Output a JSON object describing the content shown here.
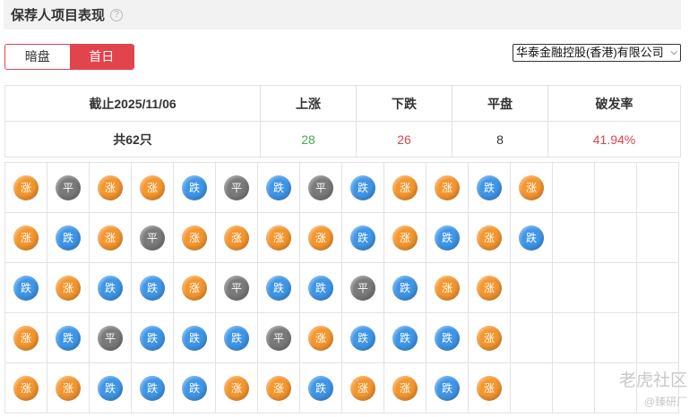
{
  "header": {
    "title": "保荐人项目表现",
    "help": "?"
  },
  "tabs": {
    "items": [
      {
        "label": "暗盘"
      },
      {
        "label": "首日"
      }
    ],
    "active": 1
  },
  "sponsor_select": {
    "value": "华泰金融控股(香港)有限公司"
  },
  "stats": {
    "as_of": "截止2025/11/06",
    "col_up": "上涨",
    "col_down": "下跌",
    "col_flat": "平盘",
    "col_rate": "破发率",
    "total": "共62只",
    "up": "28",
    "down": "26",
    "flat": "8",
    "rate": "41.94%"
  },
  "labels": {
    "up": "涨",
    "down": "跌",
    "flat": "平"
  },
  "colors": {
    "up": "#f5962e",
    "down": "#3f96e8",
    "flat": "#7a7a7a",
    "accent": "#e2444d"
  },
  "grid": {
    "rows": [
      [
        "up",
        "flat",
        "up",
        "up",
        "down",
        "flat",
        "down",
        "flat",
        "down",
        "up",
        "up",
        "down",
        "up"
      ],
      [
        "up",
        "down",
        "up",
        "flat",
        "up",
        "up",
        "up",
        "up",
        "down",
        "up",
        "down",
        "up",
        "down"
      ],
      [
        "down",
        "up",
        "down",
        "down",
        "up",
        "flat",
        "down",
        "down",
        "flat",
        "down",
        "up",
        "up"
      ],
      [
        "up",
        "down",
        "flat",
        "down",
        "down",
        "down",
        "flat",
        "up",
        "down",
        "down",
        "down",
        "up"
      ],
      [
        "up",
        "up",
        "down",
        "down",
        "down",
        "up",
        "up",
        "down",
        "up",
        "up",
        "down",
        "up"
      ]
    ]
  },
  "watermark": {
    "main": "老虎社区",
    "sub": "@臻研厂"
  }
}
